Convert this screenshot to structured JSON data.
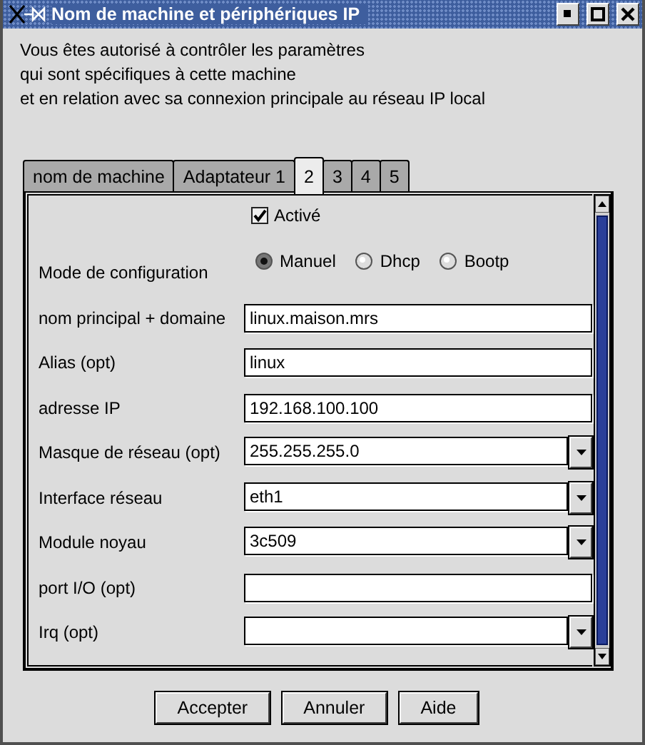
{
  "window": {
    "title": "Nom de machine et périphériques IP"
  },
  "intro": [
    "Vous êtes autorisé à contrôler les paramètres",
    "qui sont spécifiques à cette machine",
    "et en relation avec sa connexion principale au réseau IP local"
  ],
  "tabs": [
    {
      "label": "nom de machine",
      "selected": false
    },
    {
      "label": "Adaptateur 1",
      "selected": false
    },
    {
      "label": "2",
      "selected": true
    },
    {
      "label": "3",
      "selected": false
    },
    {
      "label": "4",
      "selected": false
    },
    {
      "label": "5",
      "selected": false
    }
  ],
  "enabled": {
    "label": "Activé",
    "checked": true
  },
  "config_mode": {
    "label": "Mode de configuration",
    "options": [
      {
        "label": "Manuel",
        "selected": true
      },
      {
        "label": "Dhcp",
        "selected": false
      },
      {
        "label": "Bootp",
        "selected": false
      }
    ]
  },
  "fields": [
    {
      "label": "nom principal + domaine",
      "kind": "text",
      "value": "linux.maison.mrs"
    },
    {
      "label": "Alias (opt)",
      "kind": "text",
      "value": "linux"
    },
    {
      "label": "adresse IP",
      "kind": "text",
      "value": "192.168.100.100"
    },
    {
      "label": "Masque de réseau (opt)",
      "kind": "combo",
      "value": "255.255.255.0"
    },
    {
      "label": "Interface réseau",
      "kind": "combo",
      "value": "eth1"
    },
    {
      "label": "Module noyau",
      "kind": "combo",
      "value": "3c509"
    },
    {
      "label": "port I/O (opt)",
      "kind": "text"
    },
    {
      "label": "Irq (opt)",
      "kind": "combo"
    }
  ],
  "buttons": [
    "Accepter",
    "Annuler",
    "Aide"
  ]
}
